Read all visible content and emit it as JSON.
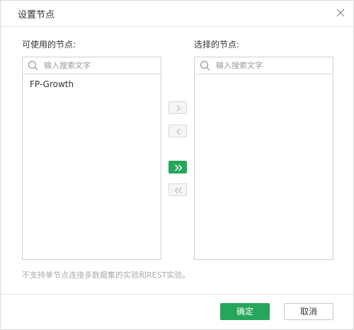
{
  "dialog": {
    "title": "设置节点",
    "close_icon": "close-icon"
  },
  "available_panel": {
    "label": "可使用的节点:",
    "search_placeholder": "输入搜索文字",
    "search_value": "",
    "items": [
      "FP-Growth"
    ]
  },
  "selected_panel": {
    "label": "选择的节点:",
    "search_placeholder": "输入搜索文字",
    "search_value": "",
    "items": []
  },
  "transfer_buttons": {
    "move_right_icon": "chevron-right-icon",
    "move_left_icon": "chevron-left-icon",
    "move_all_right_icon": "double-chevron-right-icon",
    "move_all_left_icon": "double-chevron-left-icon"
  },
  "footnote": "不支持单节点连接多数据集的实验和REST实验。",
  "footer": {
    "confirm_label": "确定",
    "cancel_label": "取消"
  },
  "colors": {
    "accent": "#26a65b",
    "border": "#cfcfcf",
    "muted_text": "#aaaaaa"
  }
}
